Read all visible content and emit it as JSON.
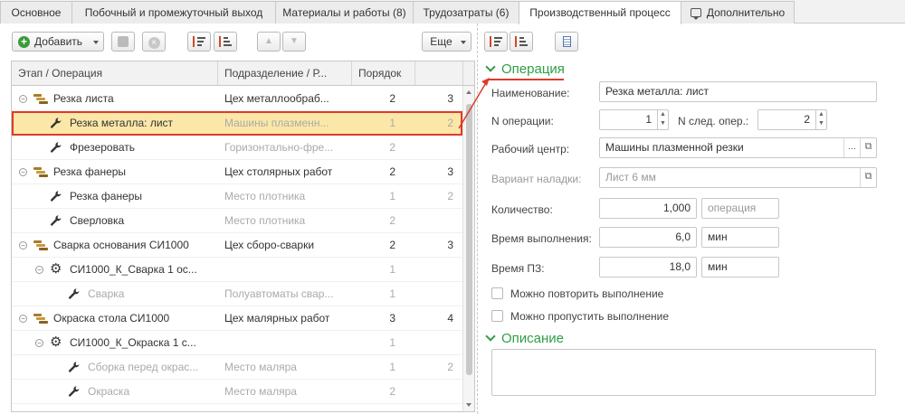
{
  "tabs": [
    {
      "label": "Основное",
      "active": false
    },
    {
      "label": "Побочный и промежуточный выход",
      "active": false
    },
    {
      "label": "Материалы и работы (8)",
      "active": false
    },
    {
      "label": "Трудозатраты (6)",
      "active": false
    },
    {
      "label": "Производственный процесс",
      "active": true
    },
    {
      "label": "Дополнительно",
      "active": false
    }
  ],
  "toolbar": {
    "add_label": "Добавить",
    "more_label": "Еще"
  },
  "table": {
    "columns": [
      "Этап / Операция",
      "Подразделение / Р...",
      "Порядок",
      ""
    ],
    "rows": [
      {
        "name": "Резка листа",
        "dept": "Цех металлообраб...",
        "order": "2",
        "next": "3",
        "type": "stage",
        "level": 0
      },
      {
        "name": "Резка металла: лист",
        "dept": "Машины плазменн...",
        "order": "1",
        "next": "2",
        "type": "operation",
        "level": 1,
        "selected": true
      },
      {
        "name": "Фрезеровать",
        "dept": "Горизонтально-фре...",
        "order": "2",
        "next": "",
        "type": "operation",
        "level": 1
      },
      {
        "name": "Резка фанеры",
        "dept": "Цех столярных работ",
        "order": "2",
        "next": "3",
        "type": "stage",
        "level": 0
      },
      {
        "name": "Резка фанеры",
        "dept": "Место плотника",
        "order": "1",
        "next": "2",
        "type": "operation",
        "level": 1
      },
      {
        "name": "Сверловка",
        "dept": "Место плотника",
        "order": "2",
        "next": "",
        "type": "operation",
        "level": 1
      },
      {
        "name": "Сварка основания СИ1000",
        "dept": "Цех сборо-сварки",
        "order": "2",
        "next": "3",
        "type": "stage",
        "level": 0
      },
      {
        "name": "СИ1000_К_Сварка 1 ос...",
        "dept": "",
        "order": "1",
        "next": "",
        "type": "process",
        "level": 1
      },
      {
        "name": "Сварка",
        "dept": "Полуавтоматы свар...",
        "order": "1",
        "next": "",
        "type": "operation",
        "level": 2
      },
      {
        "name": "Окраска стола СИ1000",
        "dept": "Цех малярных работ",
        "order": "3",
        "next": "4",
        "type": "stage",
        "level": 0
      },
      {
        "name": "СИ1000_К_Окраска 1 с...",
        "dept": "",
        "order": "1",
        "next": "",
        "type": "process",
        "level": 1
      },
      {
        "name": "Сборка перед окрас...",
        "dept": "Место маляра",
        "order": "1",
        "next": "2",
        "type": "operation",
        "level": 2
      },
      {
        "name": "Окраска",
        "dept": "Место маляра",
        "order": "2",
        "next": "",
        "type": "operation",
        "level": 2
      }
    ]
  },
  "operation": {
    "section_title": "Операция",
    "name_label": "Наименование:",
    "name_value": "Резка металла: лист",
    "op_num_label": "N операции:",
    "op_num_value": "1",
    "next_op_label": "N след. опер.:",
    "next_op_value": "2",
    "work_center_label": "Рабочий центр:",
    "work_center_value": "Машины плазменной резки",
    "setup_label": "Вариант наладки:",
    "setup_value": "Лист 6 мм",
    "qty_label": "Количество:",
    "qty_value": "1,000",
    "qty_unit": "операция",
    "exec_time_label": "Время выполнения:",
    "exec_time_value": "6,0",
    "exec_time_unit": "мин",
    "pz_time_label": "Время ПЗ:",
    "pz_time_value": "18,0",
    "pz_time_unit": "мин",
    "repeat_label": "Можно повторить выполнение",
    "skip_label": "Можно пропустить выполнение"
  },
  "description": {
    "section_title": "Описание"
  },
  "colors": {
    "accent_green": "#2e9e45",
    "selection": "#fbe7a8",
    "highlight_red": "#e03a2a"
  }
}
